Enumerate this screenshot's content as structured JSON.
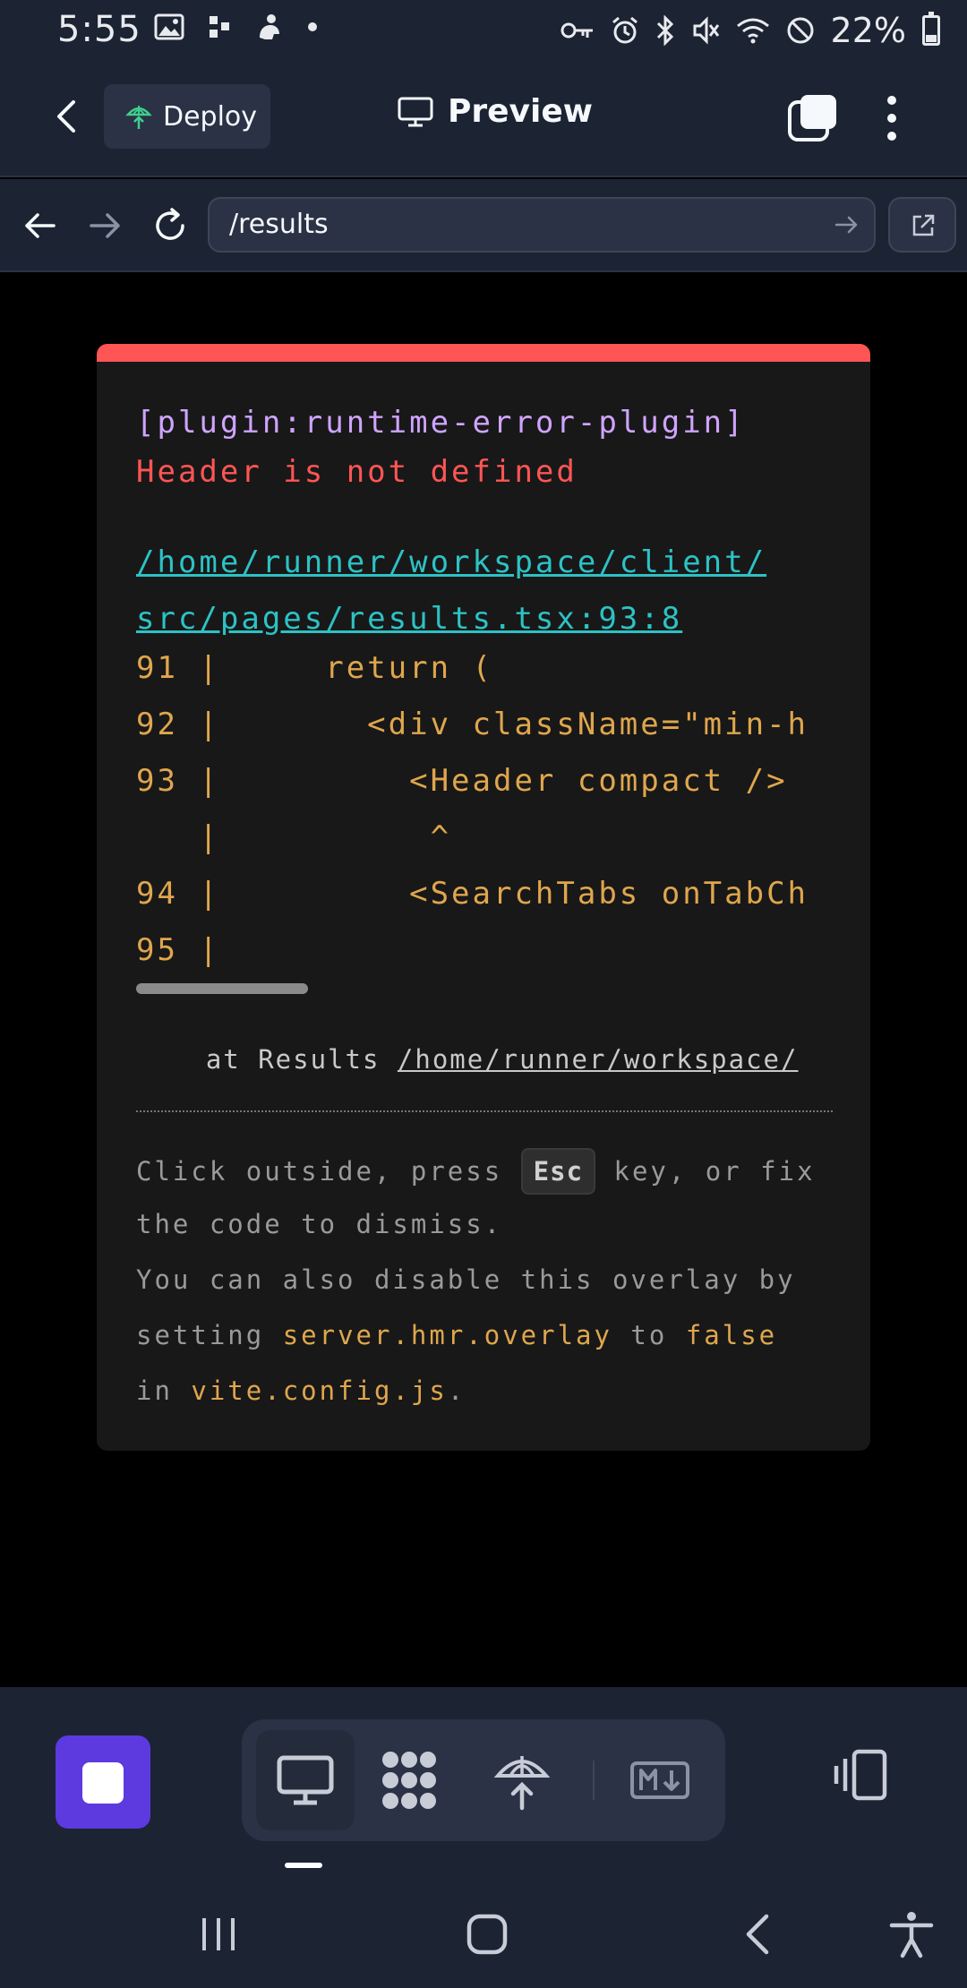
{
  "status_bar": {
    "time": "5:55",
    "battery": "22%",
    "left_icons": [
      "gallery-icon",
      "dots-icon",
      "app-icon",
      "dot-icon"
    ],
    "right_icons": [
      "key-icon",
      "alarm-icon",
      "bluetooth-icon",
      "mute-icon",
      "wifi-icon",
      "dnd-icon",
      "battery-icon"
    ]
  },
  "header": {
    "deploy_label": "Deploy",
    "title": "Preview"
  },
  "url_bar": {
    "url": "/results"
  },
  "error_overlay": {
    "plugin": "[plugin:runtime-error-plugin]",
    "message": "Header is not defined",
    "file_line1": "/home/runner/workspace/client/",
    "file_line2": "src/pages/results.tsx:93:8",
    "code_frame": [
      "91 |     return (",
      "92 |       <div className=\"min-h",
      "93 |         <Header compact />",
      "   |          ^",
      "94 |         <SearchTabs onTabCh",
      "95 |"
    ],
    "stack_prefix": "    at Results ",
    "stack_link": "/home/runner/workspace/",
    "tip": {
      "part1": "Click outside, press ",
      "key": "Esc",
      "part2": " key, or fix",
      "line2": "the code to dismiss.",
      "line3": "You can also disable this overlay by",
      "line4_prefix": "setting ",
      "line4_hl1": "server.hmr.overlay",
      "line4_mid": " to ",
      "line4_hl2": "false",
      "line5_prefix": "in ",
      "line5_hl": "vite.config.js",
      "line5_suffix": "."
    }
  },
  "toolbar": {
    "tools": [
      "preview-icon",
      "workflows-icon",
      "deploy-icon",
      "markdown-icon"
    ],
    "active_tool": "preview-icon"
  },
  "colors": {
    "app_bg": "#1c2333",
    "surface": "#2b3245",
    "error_red": "#ff5555",
    "plugin_purple": "#cfa4ff",
    "file_cyan": "#2dc2c5",
    "code_yellow": "#dfa64d",
    "stop_purple": "#5c3ae0"
  }
}
